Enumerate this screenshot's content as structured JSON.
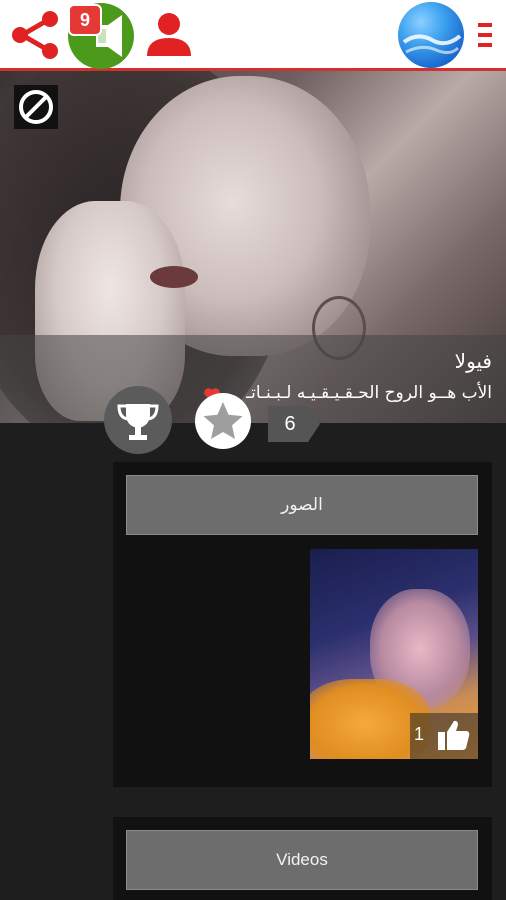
{
  "topbar": {
    "notification_count": "9",
    "icons": [
      "share-icon",
      "speaker-icon",
      "user-icon",
      "earth-icon",
      "menu-icon"
    ],
    "accent_color": "#d32f2f"
  },
  "profile": {
    "name": "فيولا",
    "status": "الأب هــو الروح الحـقـيـقـيـه لـبـنـاتـ",
    "block_icon": "block-icon",
    "rank_icon": "trophy-icon",
    "rating_icon": "star-icon",
    "rating_count": "6"
  },
  "photos": {
    "label": "الصور",
    "items": [
      {
        "likes": "1",
        "icon": "thumbs-up-icon"
      }
    ]
  },
  "videos": {
    "label": "Videos"
  }
}
